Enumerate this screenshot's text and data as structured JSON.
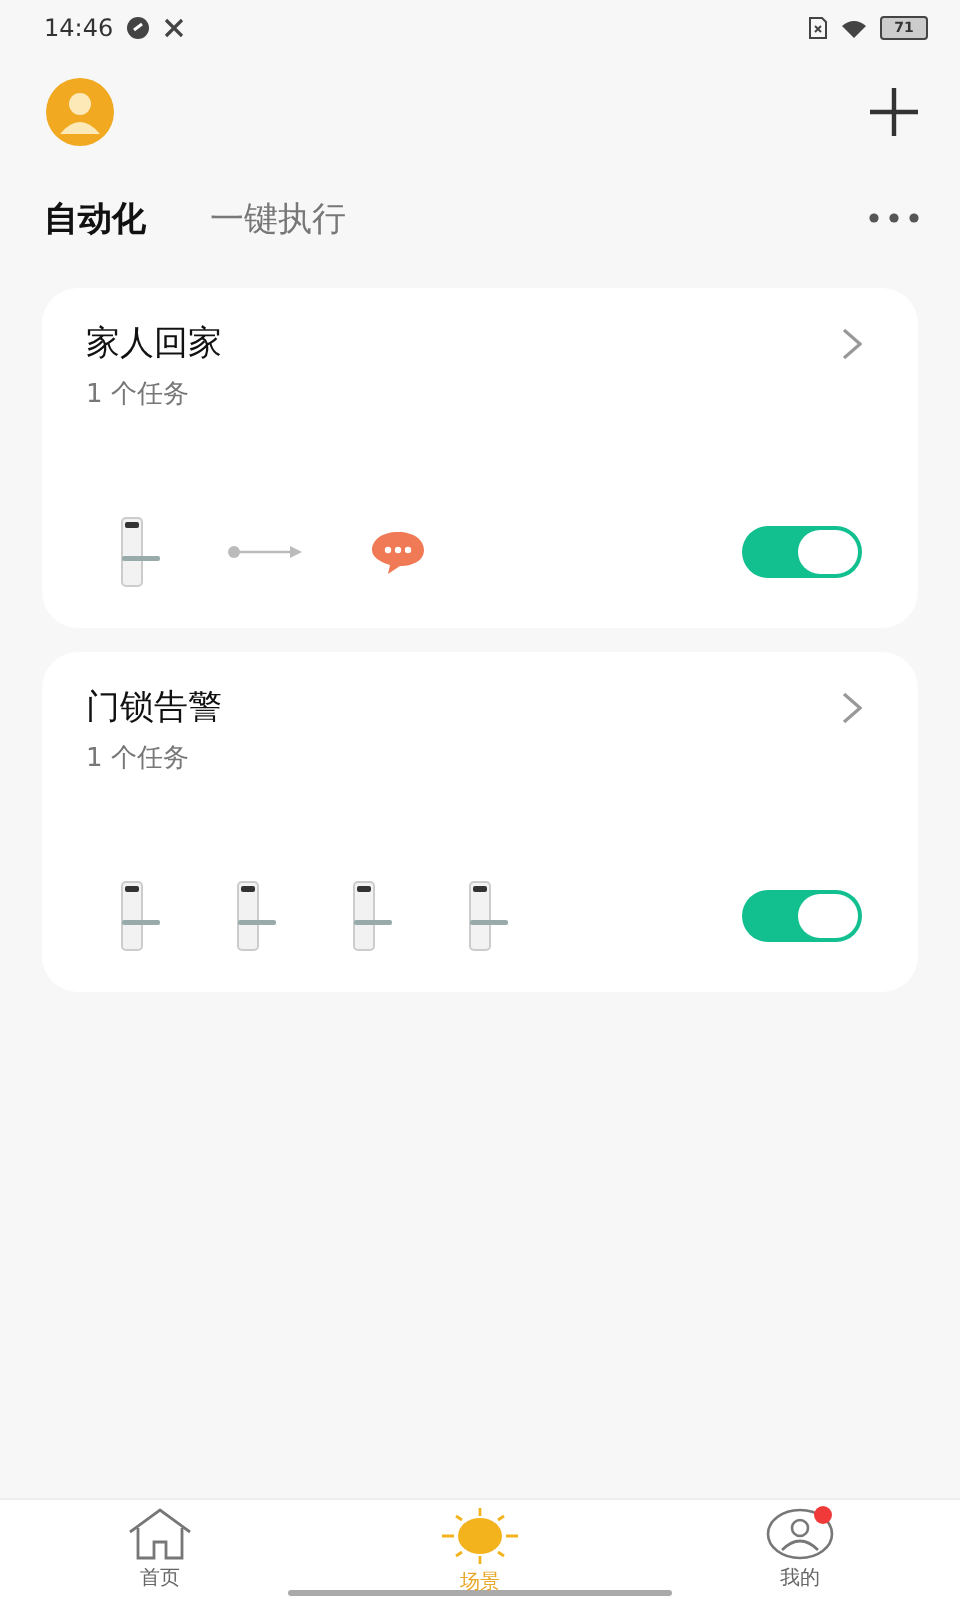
{
  "status_bar": {
    "time": "14:46",
    "battery": "71"
  },
  "tabs": [
    {
      "label": "自动化",
      "selected": true
    },
    {
      "label": "一键执行",
      "selected": false
    }
  ],
  "scenes": [
    {
      "title": "家人回家",
      "subtitle": "1 个任务",
      "on": true,
      "steps": [
        {
          "kind": "lock"
        },
        {
          "kind": "arrow"
        },
        {
          "kind": "message"
        }
      ]
    },
    {
      "title": "门锁告警",
      "subtitle": "1 个任务",
      "on": true,
      "steps": [
        {
          "kind": "lock"
        },
        {
          "kind": "lock"
        },
        {
          "kind": "lock"
        },
        {
          "kind": "lock"
        }
      ]
    }
  ],
  "nav": [
    {
      "kind": "home",
      "label": "首页",
      "selected": false,
      "badge": false
    },
    {
      "kind": "scene",
      "label": "场景",
      "selected": true,
      "badge": false
    },
    {
      "kind": "me",
      "label": "我的",
      "selected": false,
      "badge": true
    }
  ]
}
